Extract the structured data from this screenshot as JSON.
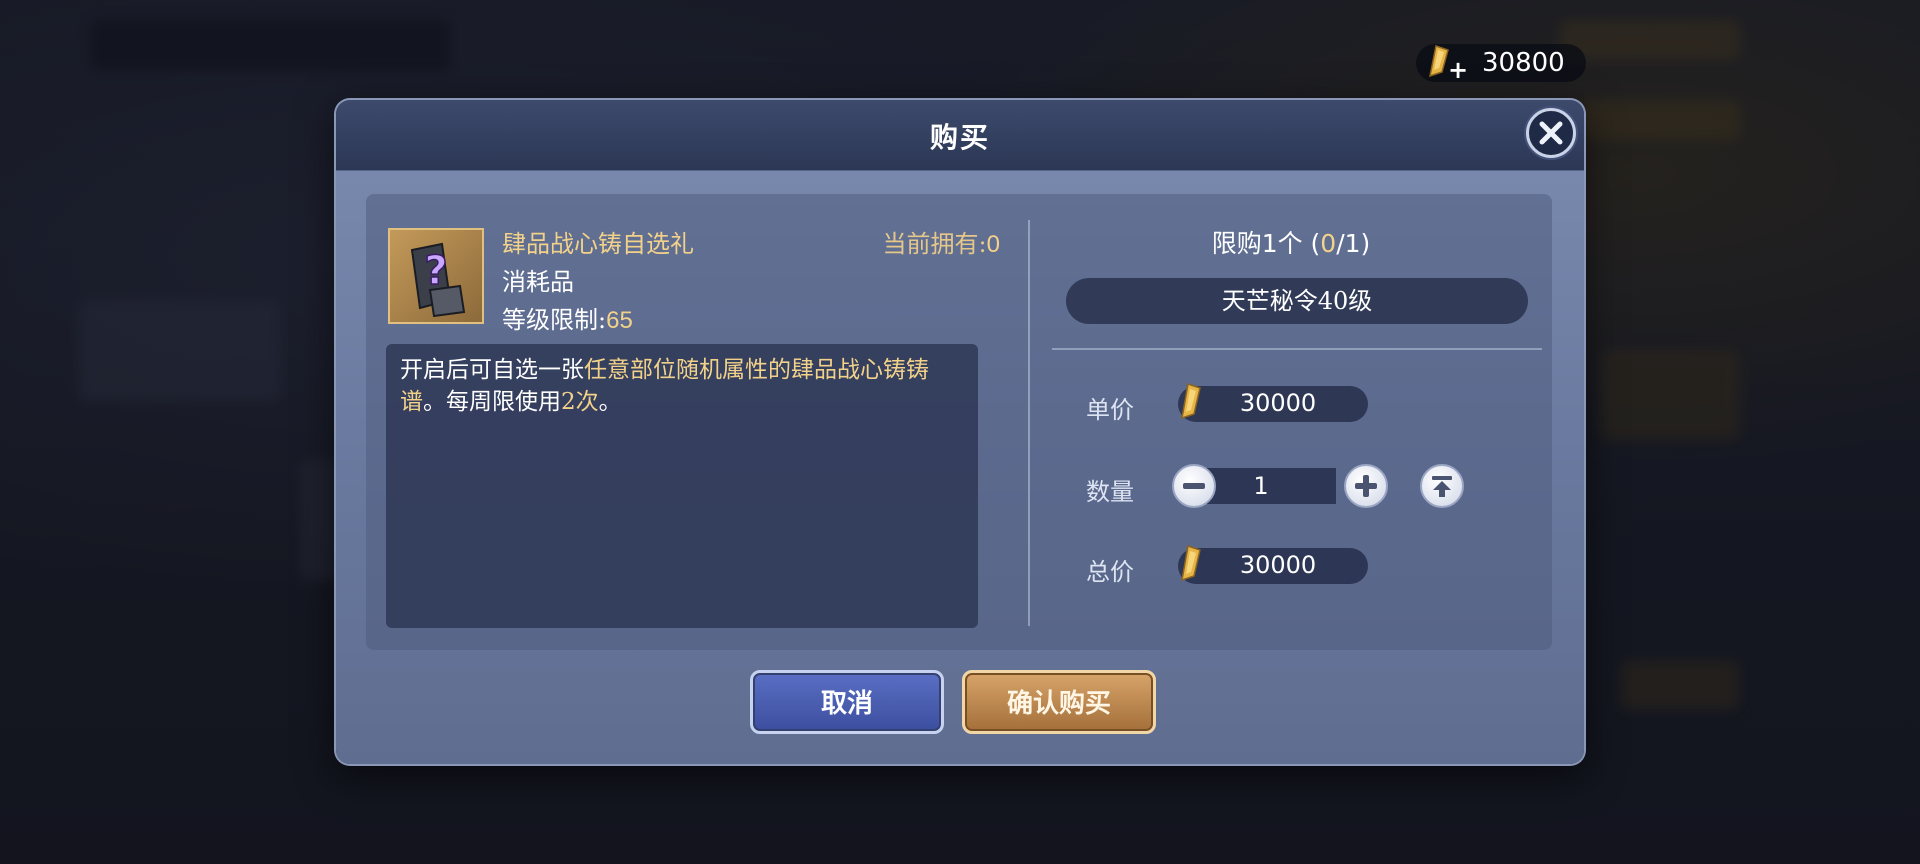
{
  "currency": {
    "amount": "30800",
    "plus": "+"
  },
  "dialog": {
    "title": "购买",
    "item": {
      "name": "肆品战心铸自选礼",
      "type": "消耗品",
      "level_label": "等级限制:",
      "level_value": "65",
      "owned_label": "当前拥有:",
      "owned_value": "0",
      "description": {
        "part1": "开启后可自选一张",
        "part2": "任意部位随机属性的肆品战心铸铸谱",
        "part3": "。每周限使用",
        "part4": "2次",
        "part5": "。"
      }
    },
    "purchase": {
      "limit_prefix": "限购1个 (",
      "limit_current": "0",
      "limit_suffix": "/1)",
      "requirement": "天芒秘令40级",
      "unit_price_label": "单价",
      "unit_price": "30000",
      "quantity_label": "数量",
      "quantity": "1",
      "total_label": "总价",
      "total_price": "30000"
    },
    "buttons": {
      "cancel": "取消",
      "confirm": "确认购买"
    }
  },
  "colors": {
    "highlight": "#f2d28a",
    "cancel": "#4a5fb4",
    "confirm": "#c28c54"
  }
}
